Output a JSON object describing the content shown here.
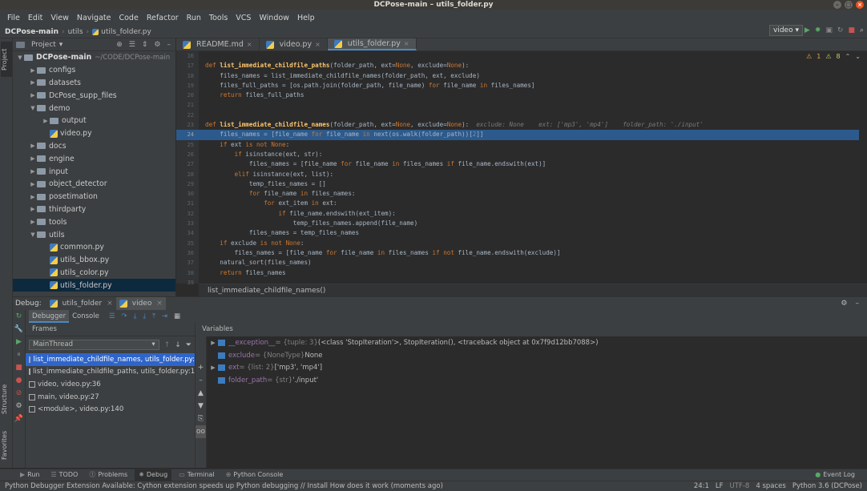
{
  "window": {
    "title": "DCPose-main – utils_folder.py"
  },
  "menu": [
    "File",
    "Edit",
    "View",
    "Navigate",
    "Code",
    "Refactor",
    "Run",
    "Tools",
    "VCS",
    "Window",
    "Help"
  ],
  "nav": {
    "project": "DCPose-main",
    "folder": "utils",
    "file": "utils_folder.py"
  },
  "run_config": "video",
  "project_panel": {
    "title": "Project",
    "root": "DCPose-main",
    "root_path": "~/CODE/DCPose-main",
    "items": [
      {
        "label": "configs",
        "type": "folder",
        "depth": 1,
        "expanded": false
      },
      {
        "label": "datasets",
        "type": "folder",
        "depth": 1,
        "expanded": false
      },
      {
        "label": "DcPose_supp_files",
        "type": "folder",
        "depth": 1,
        "expanded": false
      },
      {
        "label": "demo",
        "type": "folder",
        "depth": 1,
        "expanded": true
      },
      {
        "label": "output",
        "type": "folder",
        "depth": 2,
        "expanded": false
      },
      {
        "label": "video.py",
        "type": "py",
        "depth": 2
      },
      {
        "label": "docs",
        "type": "folder",
        "depth": 1,
        "expanded": false
      },
      {
        "label": "engine",
        "type": "folder",
        "depth": 1,
        "expanded": false
      },
      {
        "label": "input",
        "type": "folder",
        "depth": 1,
        "expanded": false
      },
      {
        "label": "object_detector",
        "type": "folder",
        "depth": 1,
        "expanded": false
      },
      {
        "label": "posetimation",
        "type": "folder",
        "depth": 1,
        "expanded": false
      },
      {
        "label": "thirdparty",
        "type": "folder",
        "depth": 1,
        "expanded": false
      },
      {
        "label": "tools",
        "type": "folder",
        "depth": 1,
        "expanded": false
      },
      {
        "label": "utils",
        "type": "folder",
        "depth": 1,
        "expanded": true
      },
      {
        "label": "common.py",
        "type": "py",
        "depth": 2
      },
      {
        "label": "utils_bbox.py",
        "type": "py",
        "depth": 2
      },
      {
        "label": "utils_color.py",
        "type": "py",
        "depth": 2
      },
      {
        "label": "utils_folder.py",
        "type": "py",
        "depth": 2,
        "selected": true
      }
    ]
  },
  "editor_tabs": [
    {
      "label": "README.md",
      "active": false
    },
    {
      "label": "video.py",
      "active": false
    },
    {
      "label": "utils_folder.py",
      "active": true
    }
  ],
  "inspection": {
    "warnings": "1",
    "weak": "8"
  },
  "code_lines": [
    {
      "n": "16",
      "html": ""
    },
    {
      "n": "17",
      "html": "<span class='kw'>def </span><span class='fn'>list_immediate_childfile_paths</span>(folder_path, ext=<span class='kw'>None</span>, exclude=<span class='kw'>None</span>):"
    },
    {
      "n": "18",
      "html": "    files_names = list_immediate_childfile_names(folder_path, ext, exclude)"
    },
    {
      "n": "19",
      "html": "    files_full_paths = [os.path.join(folder_path, file_name) <span class='kw'>for</span> file_name <span class='kw'>in</span> files_names]"
    },
    {
      "n": "20",
      "html": "    <span class='kw'>return</span> files_full_paths"
    },
    {
      "n": "21",
      "html": ""
    },
    {
      "n": "22",
      "html": ""
    },
    {
      "n": "23",
      "html": "<span class='kw'>def </span><span class='fn'>list_immediate_childfile_names</span>(folder_path, ext=<span class='kw'>None</span>, exclude=<span class='kw'>None</span>):  <span class='hint'>exclude: None    ext: ['mp3', 'mp4']    folder_path: './input'</span>"
    },
    {
      "n": "24",
      "html": "    files_names = [file_name <span class='kw'>for</span> file_name <span class='kw'>in</span> next(os.walk(folder_path))[<span class='num'>2</span>]]",
      "hl": true
    },
    {
      "n": "25",
      "html": "    <span class='kw'>if</span> ext <span class='kw'>is not None</span>:"
    },
    {
      "n": "26",
      "html": "        <span class='kw'>if</span> isinstance(ext, str):"
    },
    {
      "n": "27",
      "html": "            files_names = [file_name <span class='kw'>for</span> file_name <span class='kw'>in</span> files_names <span class='kw'>if</span> file_name.endswith(ext)]"
    },
    {
      "n": "28",
      "html": "        <span class='kw'>elif</span> isinstance(ext, list):"
    },
    {
      "n": "29",
      "html": "            temp_files_names = []"
    },
    {
      "n": "30",
      "html": "            <span class='kw'>for</span> file_name <span class='kw'>in</span> files_names:"
    },
    {
      "n": "31",
      "html": "                <span class='kw'>for</span> ext_item <span class='kw'>in</span> ext:"
    },
    {
      "n": "32",
      "html": "                    <span class='kw'>if</span> file_name.endswith(ext_item):"
    },
    {
      "n": "33",
      "html": "                        temp_files_names.append(file_name)"
    },
    {
      "n": "34",
      "html": "            files_names = temp_files_names"
    },
    {
      "n": "35",
      "html": "    <span class='kw'>if</span> exclude <span class='kw'>is not None</span>:"
    },
    {
      "n": "36",
      "html": "        files_names = [file_name <span class='kw'>for</span> file_name <span class='kw'>in</span> files_names <span class='kw'>if not</span> file_name.endswith(exclude)]"
    },
    {
      "n": "37",
      "html": "    natural_sort(files_names)"
    },
    {
      "n": "38",
      "html": "    <span class='kw'>return</span> files_names"
    },
    {
      "n": "39",
      "html": ""
    }
  ],
  "code_breadcrumb": "list_immediate_childfile_names()",
  "debug": {
    "label": "Debug:",
    "tabs": [
      {
        "label": "utils_folder",
        "active": false
      },
      {
        "label": "video",
        "active": true
      }
    ],
    "subtabs": [
      {
        "label": "Debugger",
        "active": true
      },
      {
        "label": "Console",
        "active": false
      }
    ],
    "frames_title": "Frames",
    "thread": "MainThread",
    "frames": [
      {
        "label": "list_immediate_childfile_names, utils_folder.py:",
        "selected": true
      },
      {
        "label": "list_immediate_childfile_paths, utils_folder.py:1",
        "selected": false
      },
      {
        "label": "video, video.py:36",
        "selected": false
      },
      {
        "label": "main, video.py:27",
        "selected": false
      },
      {
        "label": "<module>, video.py:140",
        "selected": false
      }
    ],
    "variables_title": "Variables",
    "variables": [
      {
        "expand": true,
        "name": "__exception__",
        "type": " = {tuple: 3} ",
        "value": "(<class 'StopIteration'>, StopIteration(), <traceback object at 0x7f9d12bb7088>)"
      },
      {
        "expand": false,
        "name": "exclude",
        "type": " = {NoneType} ",
        "value": "None"
      },
      {
        "expand": true,
        "name": "ext",
        "type": " = {list: 2} ",
        "value": "['mp3', 'mp4']"
      },
      {
        "expand": false,
        "name": "folder_path",
        "type": " = {str} ",
        "value": "'./input'"
      }
    ]
  },
  "left_strip": {
    "project": "Project",
    "structure": "Structure",
    "favorites": "Favorites"
  },
  "toolwindows": [
    {
      "label": "Run",
      "active": false
    },
    {
      "label": "TODO",
      "active": false
    },
    {
      "label": "Problems",
      "active": false
    },
    {
      "label": "Debug",
      "active": true
    },
    {
      "label": "Terminal",
      "active": false
    },
    {
      "label": "Python Console",
      "active": false
    }
  ],
  "event_log": "Event Log",
  "status": {
    "message": "Python Debugger Extension Available: Cython extension speeds up Python debugging // Install   How does it work (moments ago)",
    "position": "24:1",
    "line_sep": "LF",
    "encoding": "UTF-8",
    "indent": "4 spaces",
    "interpreter": "Python 3.6 (DCPose)"
  }
}
